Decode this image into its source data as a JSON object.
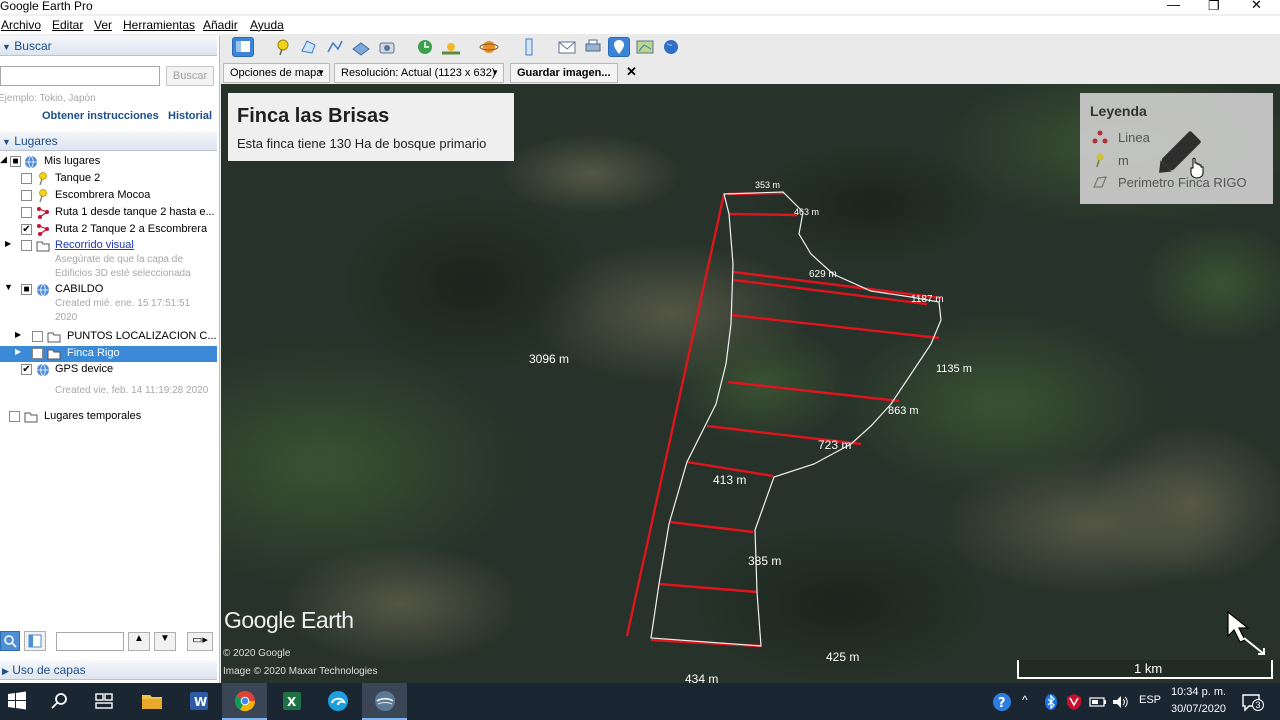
{
  "window": {
    "title": "Google Earth Pro"
  },
  "menu": [
    "Archivo",
    "Editar",
    "Ver",
    "Herramientas",
    "Añadir",
    "Ayuda"
  ],
  "search": {
    "header": "Buscar",
    "input_value": "",
    "button": "Buscar",
    "placeholder": "Ejemplo: Tokio, Japón",
    "link_directions": "Obtener instrucciones",
    "link_history": "Historial"
  },
  "places": {
    "header": "Lugares",
    "items": [
      {
        "label": "Mis lugares"
      },
      {
        "label": "Tanque 2"
      },
      {
        "label": "Escombrera Mocoa"
      },
      {
        "label": "Ruta 1 desde tanque 2 hasta e..."
      },
      {
        "label": "Ruta 2 Tanque 2 a Escombrera"
      },
      {
        "label": "Recorrido visual",
        "sub": "Asegúrate de que la capa de Edificios 3D esté seleccionada"
      },
      {
        "label": "CABILDO",
        "sub": "Created mié. ene. 15 17:51:51 2020"
      },
      {
        "label": "PUNTOS LOCALIZACION C..."
      },
      {
        "label": "Finca Rigo"
      },
      {
        "label": "GPS device",
        "sub": "Created vie. feb. 14 11:19:28 2020"
      },
      {
        "label": "Lugares temporales"
      }
    ]
  },
  "layers": {
    "header": "Uso de capas"
  },
  "options_bar": {
    "map_options": "Opciones de mapa",
    "resolution": "Resolución: Actual (1123 x 632)",
    "save": "Guardar imagen...",
    "close": "✕"
  },
  "map": {
    "title": "Finca las Brisas",
    "subtitle": "Esta finca tiene 130 Ha de bosque primario",
    "legend": {
      "title": "Leyenda",
      "items": [
        "Linea",
        "m",
        "Perimetro Finca RIGO"
      ]
    },
    "labels": [
      "353 m",
      "463 m",
      "629 m",
      "1187 m",
      "1135 m",
      "863 m",
      "723 m",
      "413 m",
      "385 m",
      "3096 m",
      "425 m",
      "434 m"
    ],
    "logo": "Google Earth",
    "copyright1": "© 2020 Google",
    "copyright2": "Image © 2020 Maxar Technologies",
    "scale": "1 km"
  },
  "taskbar": {
    "lang": "ESP",
    "time": "10:34 p. m.",
    "date": "30/07/2020",
    "notifications": "3"
  },
  "colors": {
    "accent": "#1c4d8c",
    "selection": "#3a8ad8",
    "line_red": "#e0141c"
  }
}
